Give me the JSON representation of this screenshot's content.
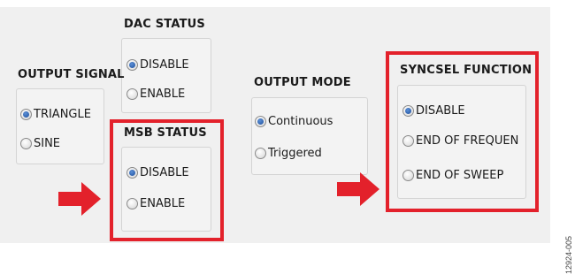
{
  "dac_status": {
    "title": "DAC STATUS",
    "options": [
      {
        "label": "DISABLE",
        "selected": true
      },
      {
        "label": "ENABLE",
        "selected": false
      }
    ]
  },
  "output_signal": {
    "title": "OUTPUT SIGNAL",
    "options": [
      {
        "label": "TRIANGLE",
        "selected": true
      },
      {
        "label": "SINE",
        "selected": false
      }
    ]
  },
  "msb_status": {
    "title": "MSB STATUS",
    "options": [
      {
        "label": "DISABLE",
        "selected": true
      },
      {
        "label": "ENABLE",
        "selected": false
      }
    ]
  },
  "output_mode": {
    "title": "OUTPUT MODE",
    "options": [
      {
        "label": "Continuous",
        "selected": true
      },
      {
        "label": "Triggered",
        "selected": false
      }
    ]
  },
  "syncsel_function": {
    "title": "SYNCSEL FUNCTION",
    "options": [
      {
        "label": "DISABLE",
        "selected": true
      },
      {
        "label": "END OF FREQUEN",
        "selected": false
      },
      {
        "label": "END OF SWEEP",
        "selected": false
      }
    ]
  },
  "figure_code": "12924-005",
  "colors": {
    "highlight_red": "#e3212b",
    "radio_selected": "#1e4f9c",
    "panel_background": "#f0f0f0"
  }
}
